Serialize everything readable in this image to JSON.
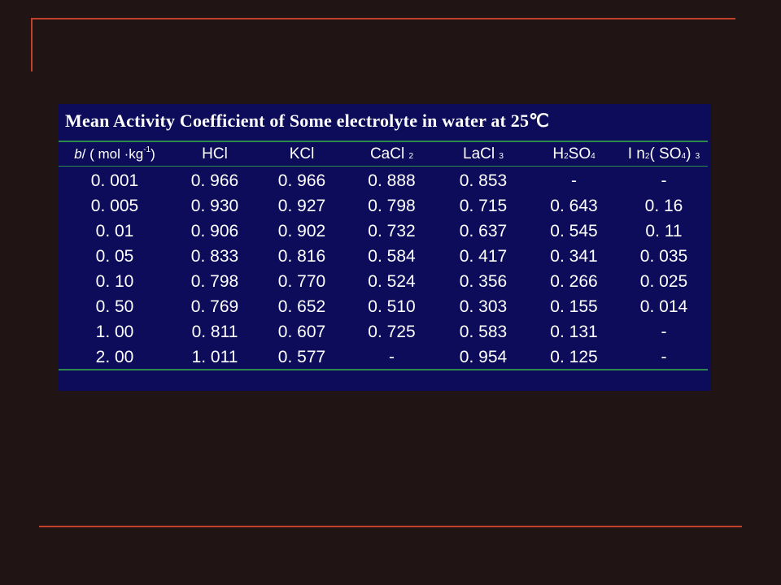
{
  "title": "Mean Activity Coefficient of Some electrolyte in water at 25℃",
  "headers": {
    "molality": {
      "b": "b",
      "rest": "/ ( mol ·kg",
      "sup": "-1",
      "close": ")"
    },
    "hcl": "HCl",
    "kcl": "KCl",
    "cacl2": {
      "base": "CaCl",
      "sub": "2"
    },
    "lacl3": {
      "base": "LaCl",
      "sub": "3"
    },
    "h2so4": {
      "a": "H",
      "sub1": "2",
      "b": "SO",
      "sub2": "4"
    },
    "in2so43": {
      "a": "I n",
      "sub1": "2",
      "b": "( SO",
      "sub2": "4",
      "c": ")",
      "sub3": "3"
    }
  },
  "rows": [
    [
      "0. 001",
      "0. 966",
      "0. 966",
      "0. 888",
      "0. 853",
      "-",
      "-"
    ],
    [
      "0. 005",
      "0. 930",
      "0. 927",
      "0. 798",
      "0. 715",
      "0. 643",
      "0. 16"
    ],
    [
      "0. 01",
      "0. 906",
      "0. 902",
      "0. 732",
      "0. 637",
      "0. 545",
      "0. 11"
    ],
    [
      "0. 05",
      "0. 833",
      "0. 816",
      "0. 584",
      "0. 417",
      "0. 341",
      "0. 035"
    ],
    [
      "0. 10",
      "0. 798",
      "0. 770",
      "0. 524",
      "0. 356",
      "0. 266",
      "0. 025"
    ],
    [
      "0. 50",
      "0. 769",
      "0. 652",
      "0. 510",
      "0. 303",
      "0. 155",
      "0. 014"
    ],
    [
      "1. 00",
      "0. 811",
      "0. 607",
      "0. 725",
      "0. 583",
      "0. 131",
      "-"
    ],
    [
      "2. 00",
      "1. 011",
      "0. 577",
      "-",
      "0. 954",
      "0. 125",
      "-"
    ]
  ],
  "colors": {
    "background": "#201414",
    "rule": "#c0402a",
    "panel": "#0c0c5a",
    "divider": "#2e8a4a",
    "text": "#ffffff"
  }
}
